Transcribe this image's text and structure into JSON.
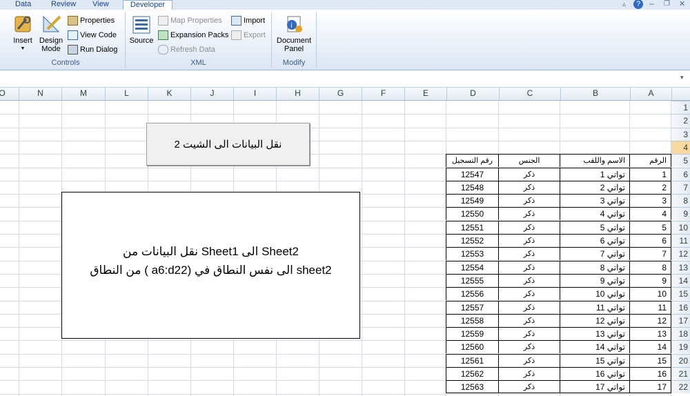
{
  "ribbon": {
    "tabs": [
      "Data",
      "Review",
      "View",
      "Developer"
    ],
    "active_tab": "Developer",
    "controls": {
      "insert": "Insert",
      "design_mode_1": "Design",
      "design_mode_2": "Mode",
      "properties": "Properties",
      "view_code": "View Code",
      "run_dialog": "Run Dialog",
      "group": "Controls"
    },
    "xml": {
      "source": "Source",
      "map_properties": "Map Properties",
      "expansion_packs": "Expansion Packs",
      "refresh_data": "Refresh Data",
      "import": "Import",
      "export": "Export",
      "group": "XML"
    },
    "modify": {
      "document_panel_1": "Document",
      "document_panel_2": "Panel",
      "group": "Modify"
    }
  },
  "sheet": {
    "columns": [
      "O",
      "N",
      "M",
      "L",
      "K",
      "J",
      "I",
      "H",
      "G",
      "F",
      "E",
      "D",
      "C",
      "B",
      "A"
    ],
    "rows": [
      "1",
      "2",
      "3",
      "4",
      "5",
      "6",
      "7",
      "8",
      "9",
      "10",
      "11",
      "12",
      "13",
      "14",
      "15",
      "16",
      "17",
      "18",
      "19",
      "20",
      "21",
      "22"
    ],
    "selected_row": "4",
    "button_label": "نقل البيانات الى الشيت 2",
    "note_line1": "نقل البيانات من Sheet1 الى Sheet2",
    "note_line2": "من النطاق ( a6:d22) الى نفس النطاق في sheet2",
    "table": {
      "headers": [
        "الرقم",
        "الاسم واللقب",
        "الجنس",
        "رقم التسجيل"
      ],
      "rows": [
        [
          "1",
          "تواتي 1",
          "ذكر",
          "12547"
        ],
        [
          "2",
          "تواتي 2",
          "ذكر",
          "12548"
        ],
        [
          "3",
          "تواتي 3",
          "ذكر",
          "12549"
        ],
        [
          "4",
          "تواتي 4",
          "ذكر",
          "12550"
        ],
        [
          "5",
          "تواتي 5",
          "ذكر",
          "12551"
        ],
        [
          "6",
          "تواتي 6",
          "ذكر",
          "12552"
        ],
        [
          "7",
          "تواتي 7",
          "ذكر",
          "12553"
        ],
        [
          "8",
          "تواتي 8",
          "ذكر",
          "12554"
        ],
        [
          "9",
          "تواتي 9",
          "ذكر",
          "12555"
        ],
        [
          "10",
          "تواتي 10",
          "ذكر",
          "12556"
        ],
        [
          "11",
          "تواتي 11",
          "ذكر",
          "12557"
        ],
        [
          "12",
          "تواتي 12",
          "ذكر",
          "12558"
        ],
        [
          "13",
          "تواتي 13",
          "ذكر",
          "12559"
        ],
        [
          "14",
          "تواتي 14",
          "ذكر",
          "12560"
        ],
        [
          "15",
          "تواتي 15",
          "ذكر",
          "12561"
        ],
        [
          "16",
          "تواتي 16",
          "ذكر",
          "12562"
        ],
        [
          "17",
          "تواتي 17",
          "ذكر",
          "12563"
        ]
      ]
    }
  }
}
